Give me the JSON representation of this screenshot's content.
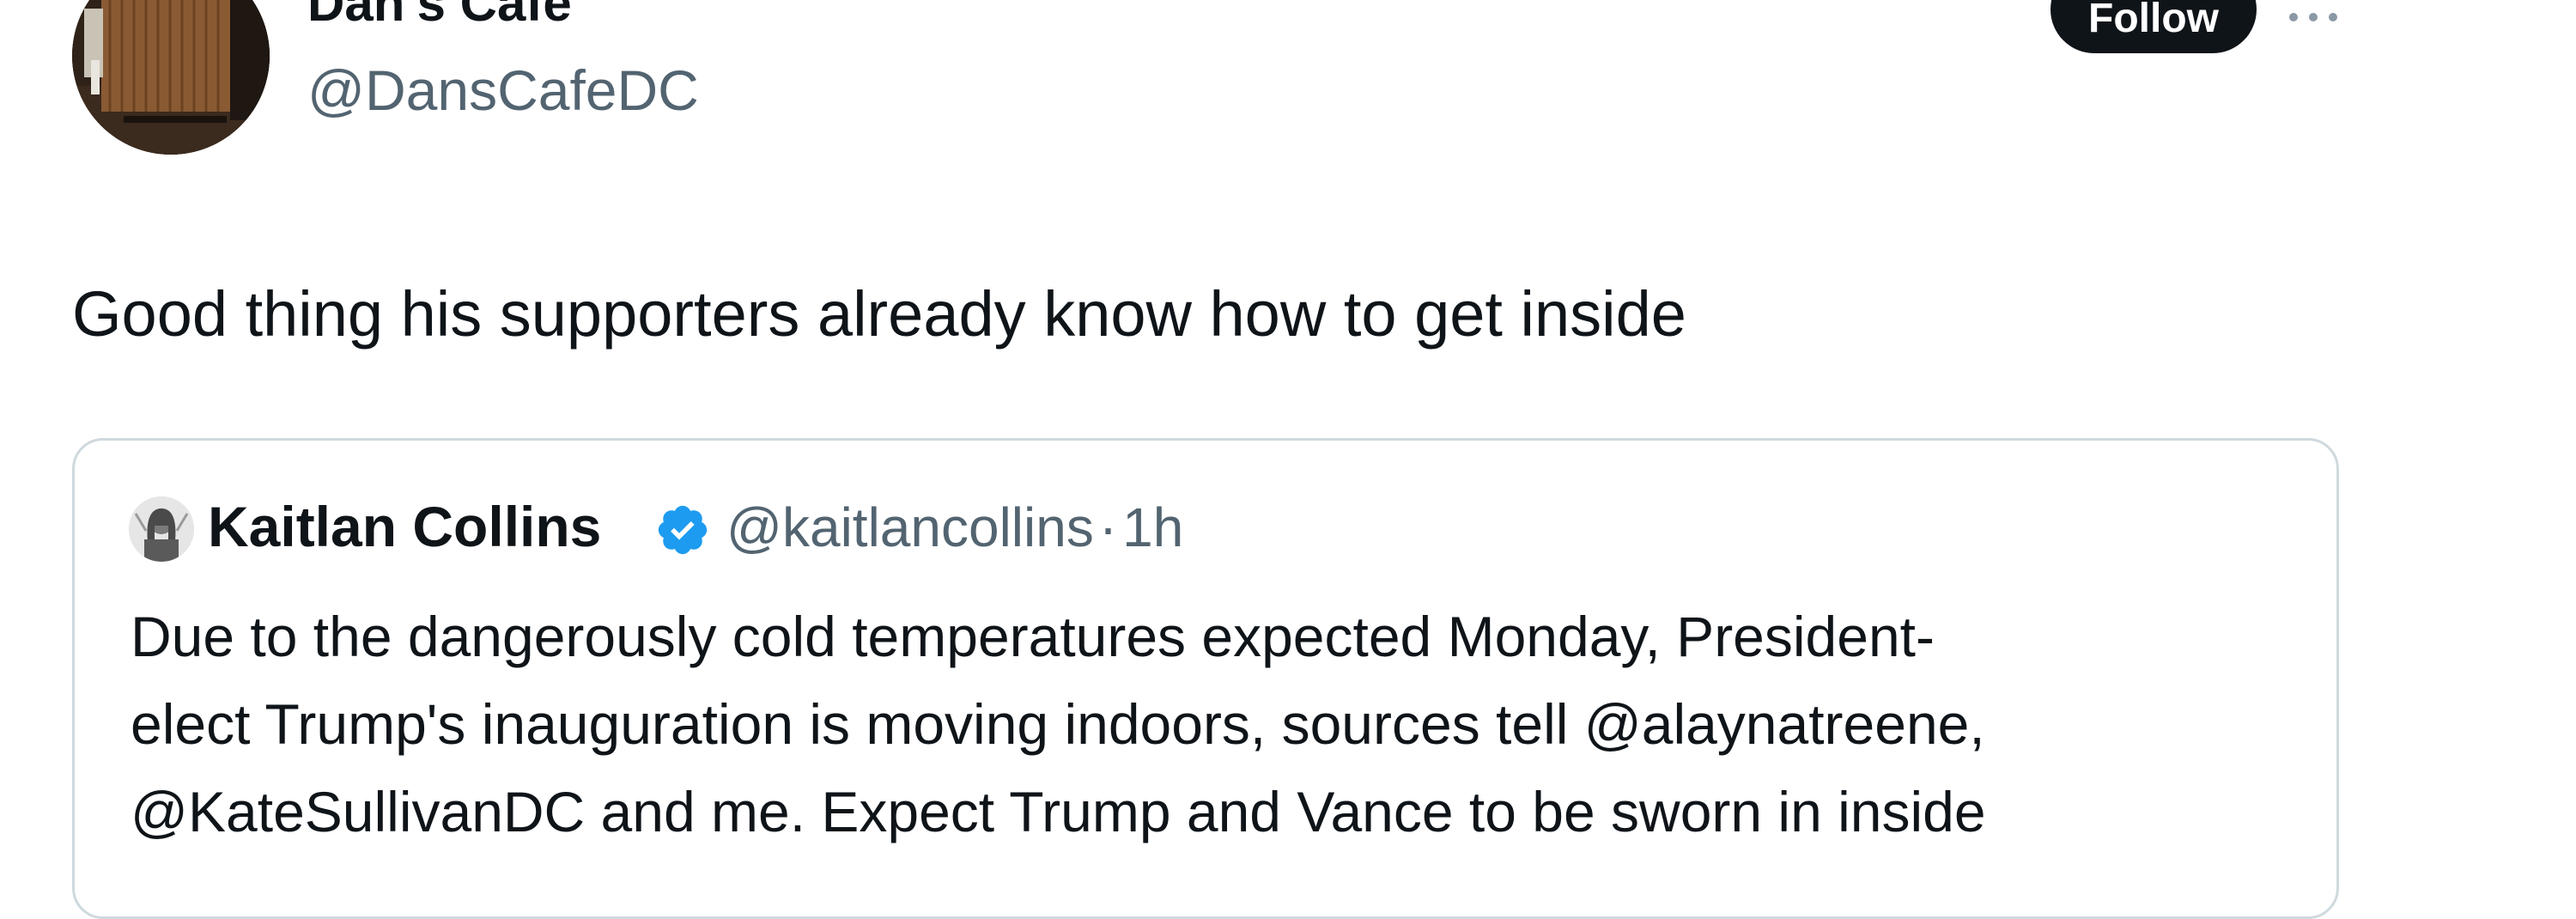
{
  "author": {
    "display_name": "Dan's Cafe",
    "handle": "@DansCafeDC",
    "avatar_icon": "cafe-storefront-photo"
  },
  "actions": {
    "follow_label": "Follow",
    "more_icon": "more-horizontal-icon"
  },
  "tweet": {
    "text": "Good thing his supporters already know how to get inside"
  },
  "quoted_tweet": {
    "author_name": "Kaitlan Collins",
    "verified": true,
    "verified_color": "#1d9bf0",
    "handle": "@kaitlancollins",
    "separator": "·",
    "time": "1h",
    "text_lines": [
      "Due to the dangerously cold temperatures expected Monday, President-",
      "elect Trump's inauguration is moving indoors, sources tell @alaynatreene,",
      "@KateSullivanDC and me. Expect Trump and Vance to be sworn in inside"
    ]
  },
  "colors": {
    "text_primary": "#0f1419",
    "text_secondary": "#536471",
    "border": "#cfd9de",
    "follow_bg": "#0f1419"
  }
}
